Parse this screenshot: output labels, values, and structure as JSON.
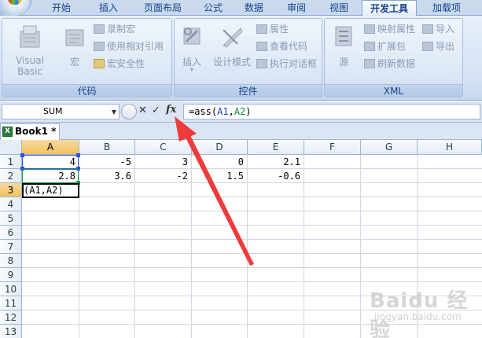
{
  "ribbon_tabs": [
    "开始",
    "插入",
    "页面布局",
    "公式",
    "数据",
    "审阅",
    "视图",
    "开发工具",
    "加载项"
  ],
  "active_tab": "开发工具",
  "groups": {
    "code": {
      "label": "代码",
      "visual_basic": "Visual Basic",
      "macro": "宏",
      "record_macro": "录制宏",
      "relative_ref": "使用相对引用",
      "macro_security": "宏安全性"
    },
    "controls": {
      "label": "控件",
      "insert": "插入",
      "design_mode": "设计模式",
      "properties": "属性",
      "view_code": "查看代码",
      "run_dialog": "执行对话框"
    },
    "xml": {
      "label": "XML",
      "source": "源",
      "map_properties": "映射属性",
      "expansion_packs": "扩展包",
      "refresh_data": "刷新数据",
      "import": "导入",
      "export": "导出"
    }
  },
  "formula_bar": {
    "name_box": "SUM",
    "fx": "fx",
    "formula_prefix": "=ass(",
    "ref1": "A1",
    "sep": ",",
    "ref2": "A2",
    "formula_suffix": ")"
  },
  "workbook_tab": "Book1 *",
  "columns": [
    "A",
    "B",
    "C",
    "D",
    "E",
    "F",
    "G",
    "H"
  ],
  "rows": [
    "1",
    "2",
    "3",
    "4",
    "5",
    "6",
    "7",
    "8",
    "9",
    "10",
    "11",
    "12",
    "13"
  ],
  "cells": {
    "A1": "4",
    "B1": "-5",
    "C1": "3",
    "D1": "0",
    "E1": "2.1",
    "A2": "2.8",
    "B2": "3.6",
    "C2": "-2",
    "D2": "1.5",
    "E2": "-0.6",
    "A3": "(A1,A2)"
  },
  "colors": {
    "ref_a1": "#1a3fd6",
    "ref_a2": "#0a8a3b",
    "arrow": "#ef3b3b"
  },
  "watermark": {
    "brand": "Baidu 经验",
    "url": "jingyan.baidu.com"
  }
}
